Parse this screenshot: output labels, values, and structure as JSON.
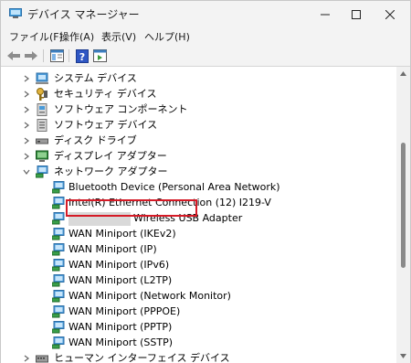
{
  "window": {
    "title": "デバイス マネージャー",
    "controls": [
      "minimize",
      "maximize",
      "close"
    ]
  },
  "menu": [
    {
      "label": "ファイル(F)"
    },
    {
      "label": "操作(A)"
    },
    {
      "label": "表示(V)"
    },
    {
      "label": "ヘルプ(H)"
    }
  ],
  "toolbar": {
    "buttons": [
      "back-arrow-icon",
      "forward-arrow-icon",
      "properties-icon",
      "help-icon",
      "action-pane-icon"
    ]
  },
  "tree": {
    "categories": [
      {
        "label": "システム デバイス",
        "expanded": false
      },
      {
        "label": "セキュリティ デバイス",
        "expanded": false
      },
      {
        "label": "ソフトウェア コンポーネント",
        "expanded": false
      },
      {
        "label": "ソフトウェア デバイス",
        "expanded": false
      },
      {
        "label": "ディスク ドライブ",
        "expanded": false
      },
      {
        "label": "ディスプレイ アダプター",
        "expanded": false
      },
      {
        "label": "ネットワーク アダプター",
        "expanded": true
      }
    ],
    "network_adapters": [
      {
        "label": "Bluetooth Device (Personal Area Network)"
      },
      {
        "label": "Intel(R) Ethernet Connection (12) I219-V"
      },
      {
        "label": "Wireless USB Adapter",
        "redacted_prefix": true,
        "highlighted": true
      },
      {
        "label": "WAN Miniport (IKEv2)"
      },
      {
        "label": "WAN Miniport (IP)"
      },
      {
        "label": "WAN Miniport (IPv6)"
      },
      {
        "label": "WAN Miniport (L2TP)"
      },
      {
        "label": "WAN Miniport (Network Monitor)"
      },
      {
        "label": "WAN Miniport (PPPOE)"
      },
      {
        "label": "WAN Miniport (PPTP)"
      },
      {
        "label": "WAN Miniport (SSTP)"
      }
    ],
    "trailing_category": {
      "label": "ヒューマン インターフェイス デバイス",
      "expanded": false
    }
  },
  "colors": {
    "highlight_border": "#d51a26",
    "window_bg": "#f3f3f3",
    "tree_bg": "#ffffff"
  }
}
